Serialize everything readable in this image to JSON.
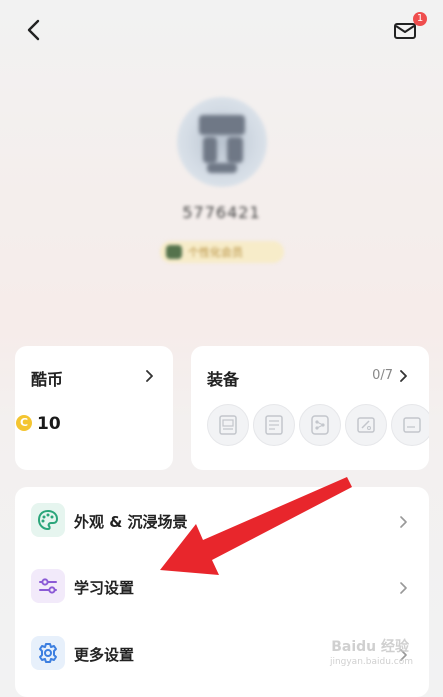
{
  "header": {
    "back_icon": "chevron-left-icon",
    "mail_icon": "mail-icon",
    "mail_badge": "1"
  },
  "profile": {
    "username": "5776421",
    "vip_label": "个性化会员"
  },
  "coins": {
    "title": "酷币",
    "value": "10",
    "coin_symbol": "C"
  },
  "equipment": {
    "title": "装备",
    "count": "0/7"
  },
  "settings": {
    "items": [
      {
        "label": "外观 & 沉浸场景",
        "icon": "palette-icon"
      },
      {
        "label": "学习设置",
        "icon": "sliders-icon"
      },
      {
        "label": "更多设置",
        "icon": "gear-icon"
      }
    ]
  },
  "watermark": {
    "text": "Baidu 经验",
    "sub": "jingyan.baidu.com"
  },
  "colors": {
    "accent_red": "#e8262c",
    "badge_red": "#ef4d4d",
    "coin_gold": "#f4c531"
  }
}
